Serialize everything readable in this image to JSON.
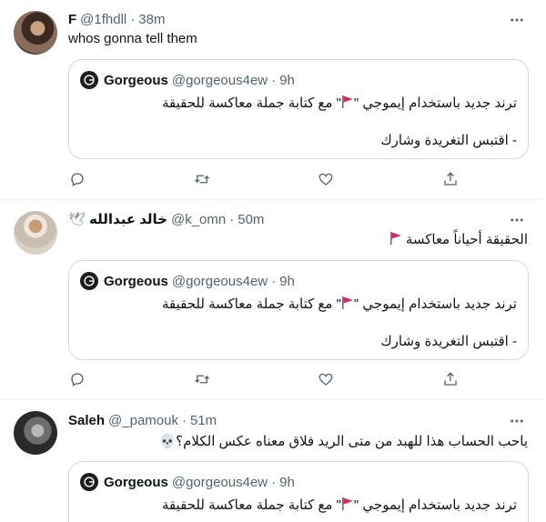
{
  "quoted_tweet": {
    "name": "Gorgeous",
    "handle": "@gorgeous4ew",
    "dot": "·",
    "time": "9h",
    "line1_before": "ترند جديد باستخدام إيموجي \"",
    "line1_after": "\" مع كتابة جملة معاكسة للحقيقة",
    "line2": "- اقتبس التغريدة وشارك"
  },
  "tweets": [
    {
      "name": "F",
      "handle": "@1fhdll",
      "dot": "·",
      "time": "38m",
      "text": "whos gonna tell them"
    },
    {
      "name": "خالد عبدالله",
      "name_emoji": "🕊",
      "handle": "@k_omn",
      "dot": "·",
      "time": "50m",
      "text": "الحقيقة أحياناً معاكسة"
    },
    {
      "name": "Saleh",
      "handle": "@_pamouk",
      "dot": "·",
      "time": "51m",
      "text": "ياحب الحساب هذا للهبد من متى الريد فلاق معناه عكس الكلام؟",
      "text_emoji": "💀"
    }
  ],
  "colors": {
    "text": "#0f1419",
    "secondary": "#536471",
    "border": "#cfd9de",
    "divider": "#eff3f4",
    "flag": "#e0245e"
  },
  "icons": [
    "more-icon",
    "reply-icon",
    "retweet-icon",
    "like-icon",
    "share-icon",
    "red-flag-icon"
  ]
}
